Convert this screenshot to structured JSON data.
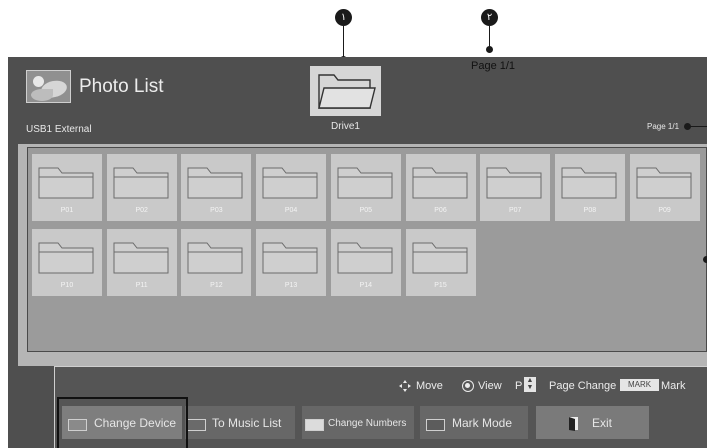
{
  "callouts": {
    "first": "١",
    "second": "٢"
  },
  "header": {
    "title": "Photo List",
    "device": "USB1 External",
    "drive_label": "Drive1",
    "page_top": "Page 1/1",
    "page_right": "Page 1/1"
  },
  "folders": [
    "P01",
    "P02",
    "P03",
    "P04",
    "P05",
    "P06",
    "P07",
    "P08",
    "P09",
    "P10",
    "P11",
    "P12",
    "P13",
    "P14",
    "P15"
  ],
  "hints": {
    "move": "Move",
    "view": "View",
    "p_key": "P",
    "page_change": "Page Change",
    "mark_key": "MARK",
    "mark": "Mark"
  },
  "buttons": {
    "change_device": "Change Device",
    "to_music_list": "To Music List",
    "change_numbers": "Change Numbers",
    "mark_mode": "Mark Mode",
    "exit": "Exit"
  },
  "colors": {
    "red": "#8a8a8a",
    "green": "#6a6a6a",
    "yellow": "#dcdcdc",
    "blue": "#5c5c5c"
  }
}
